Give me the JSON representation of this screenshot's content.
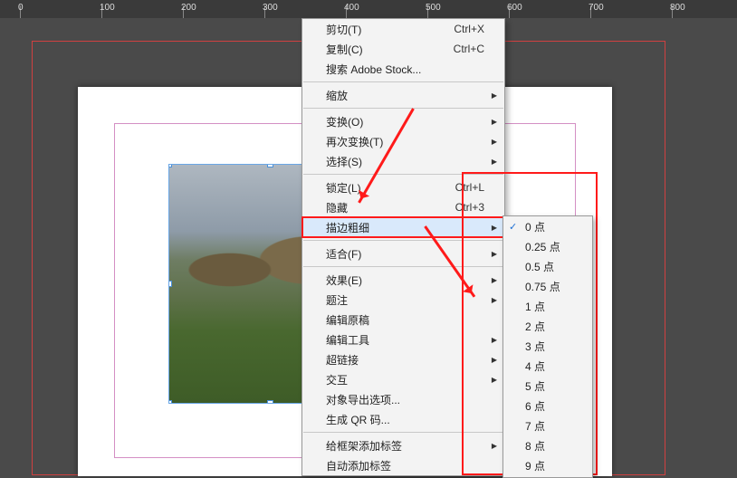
{
  "ruler": {
    "marks": [
      "0",
      "100",
      "200",
      "300",
      "400",
      "500",
      "600",
      "700",
      "800"
    ]
  },
  "context_menu": {
    "groups": [
      [
        {
          "label": "剪切(T)",
          "shortcut": "Ctrl+X",
          "sub": false
        },
        {
          "label": "复制(C)",
          "shortcut": "Ctrl+C",
          "sub": false
        },
        {
          "label": "搜索 Adobe Stock...",
          "shortcut": "",
          "sub": false
        }
      ],
      [
        {
          "label": "缩放",
          "shortcut": "",
          "sub": true
        }
      ],
      [
        {
          "label": "变换(O)",
          "shortcut": "",
          "sub": true
        },
        {
          "label": "再次变换(T)",
          "shortcut": "",
          "sub": true
        },
        {
          "label": "选择(S)",
          "shortcut": "",
          "sub": true
        }
      ],
      [
        {
          "label": "锁定(L)",
          "shortcut": "Ctrl+L",
          "sub": false
        },
        {
          "label": "隐藏",
          "shortcut": "Ctrl+3",
          "sub": false
        },
        {
          "label": "描边粗细",
          "shortcut": "",
          "sub": true,
          "highlight": true,
          "redbox": true
        }
      ],
      [
        {
          "label": "适合(F)",
          "shortcut": "",
          "sub": true
        }
      ],
      [
        {
          "label": "效果(E)",
          "shortcut": "",
          "sub": true
        },
        {
          "label": "题注",
          "shortcut": "",
          "sub": true
        },
        {
          "label": "编辑原稿",
          "shortcut": "",
          "sub": false
        },
        {
          "label": "编辑工具",
          "shortcut": "",
          "sub": true
        },
        {
          "label": "超链接",
          "shortcut": "",
          "sub": true
        },
        {
          "label": "交互",
          "shortcut": "",
          "sub": true
        },
        {
          "label": "对象导出选项...",
          "shortcut": "",
          "sub": false
        },
        {
          "label": "生成 QR 码...",
          "shortcut": "",
          "sub": false
        }
      ],
      [
        {
          "label": "给框架添加标签",
          "shortcut": "",
          "sub": true
        },
        {
          "label": "自动添加标签",
          "shortcut": "",
          "sub": false
        }
      ]
    ]
  },
  "submenu_stroke": {
    "items": [
      {
        "label": "0 点",
        "checked": true
      },
      {
        "label": "0.25 点",
        "checked": false
      },
      {
        "label": "0.5 点",
        "checked": false
      },
      {
        "label": "0.75 点",
        "checked": false
      },
      {
        "label": "1 点",
        "checked": false
      },
      {
        "label": "2 点",
        "checked": false
      },
      {
        "label": "3 点",
        "checked": false
      },
      {
        "label": "4 点",
        "checked": false
      },
      {
        "label": "5 点",
        "checked": false
      },
      {
        "label": "6 点",
        "checked": false
      },
      {
        "label": "7 点",
        "checked": false
      },
      {
        "label": "8 点",
        "checked": false
      },
      {
        "label": "9 点",
        "checked": false
      }
    ]
  },
  "image_frame": {
    "link_glyph": "⛓"
  }
}
